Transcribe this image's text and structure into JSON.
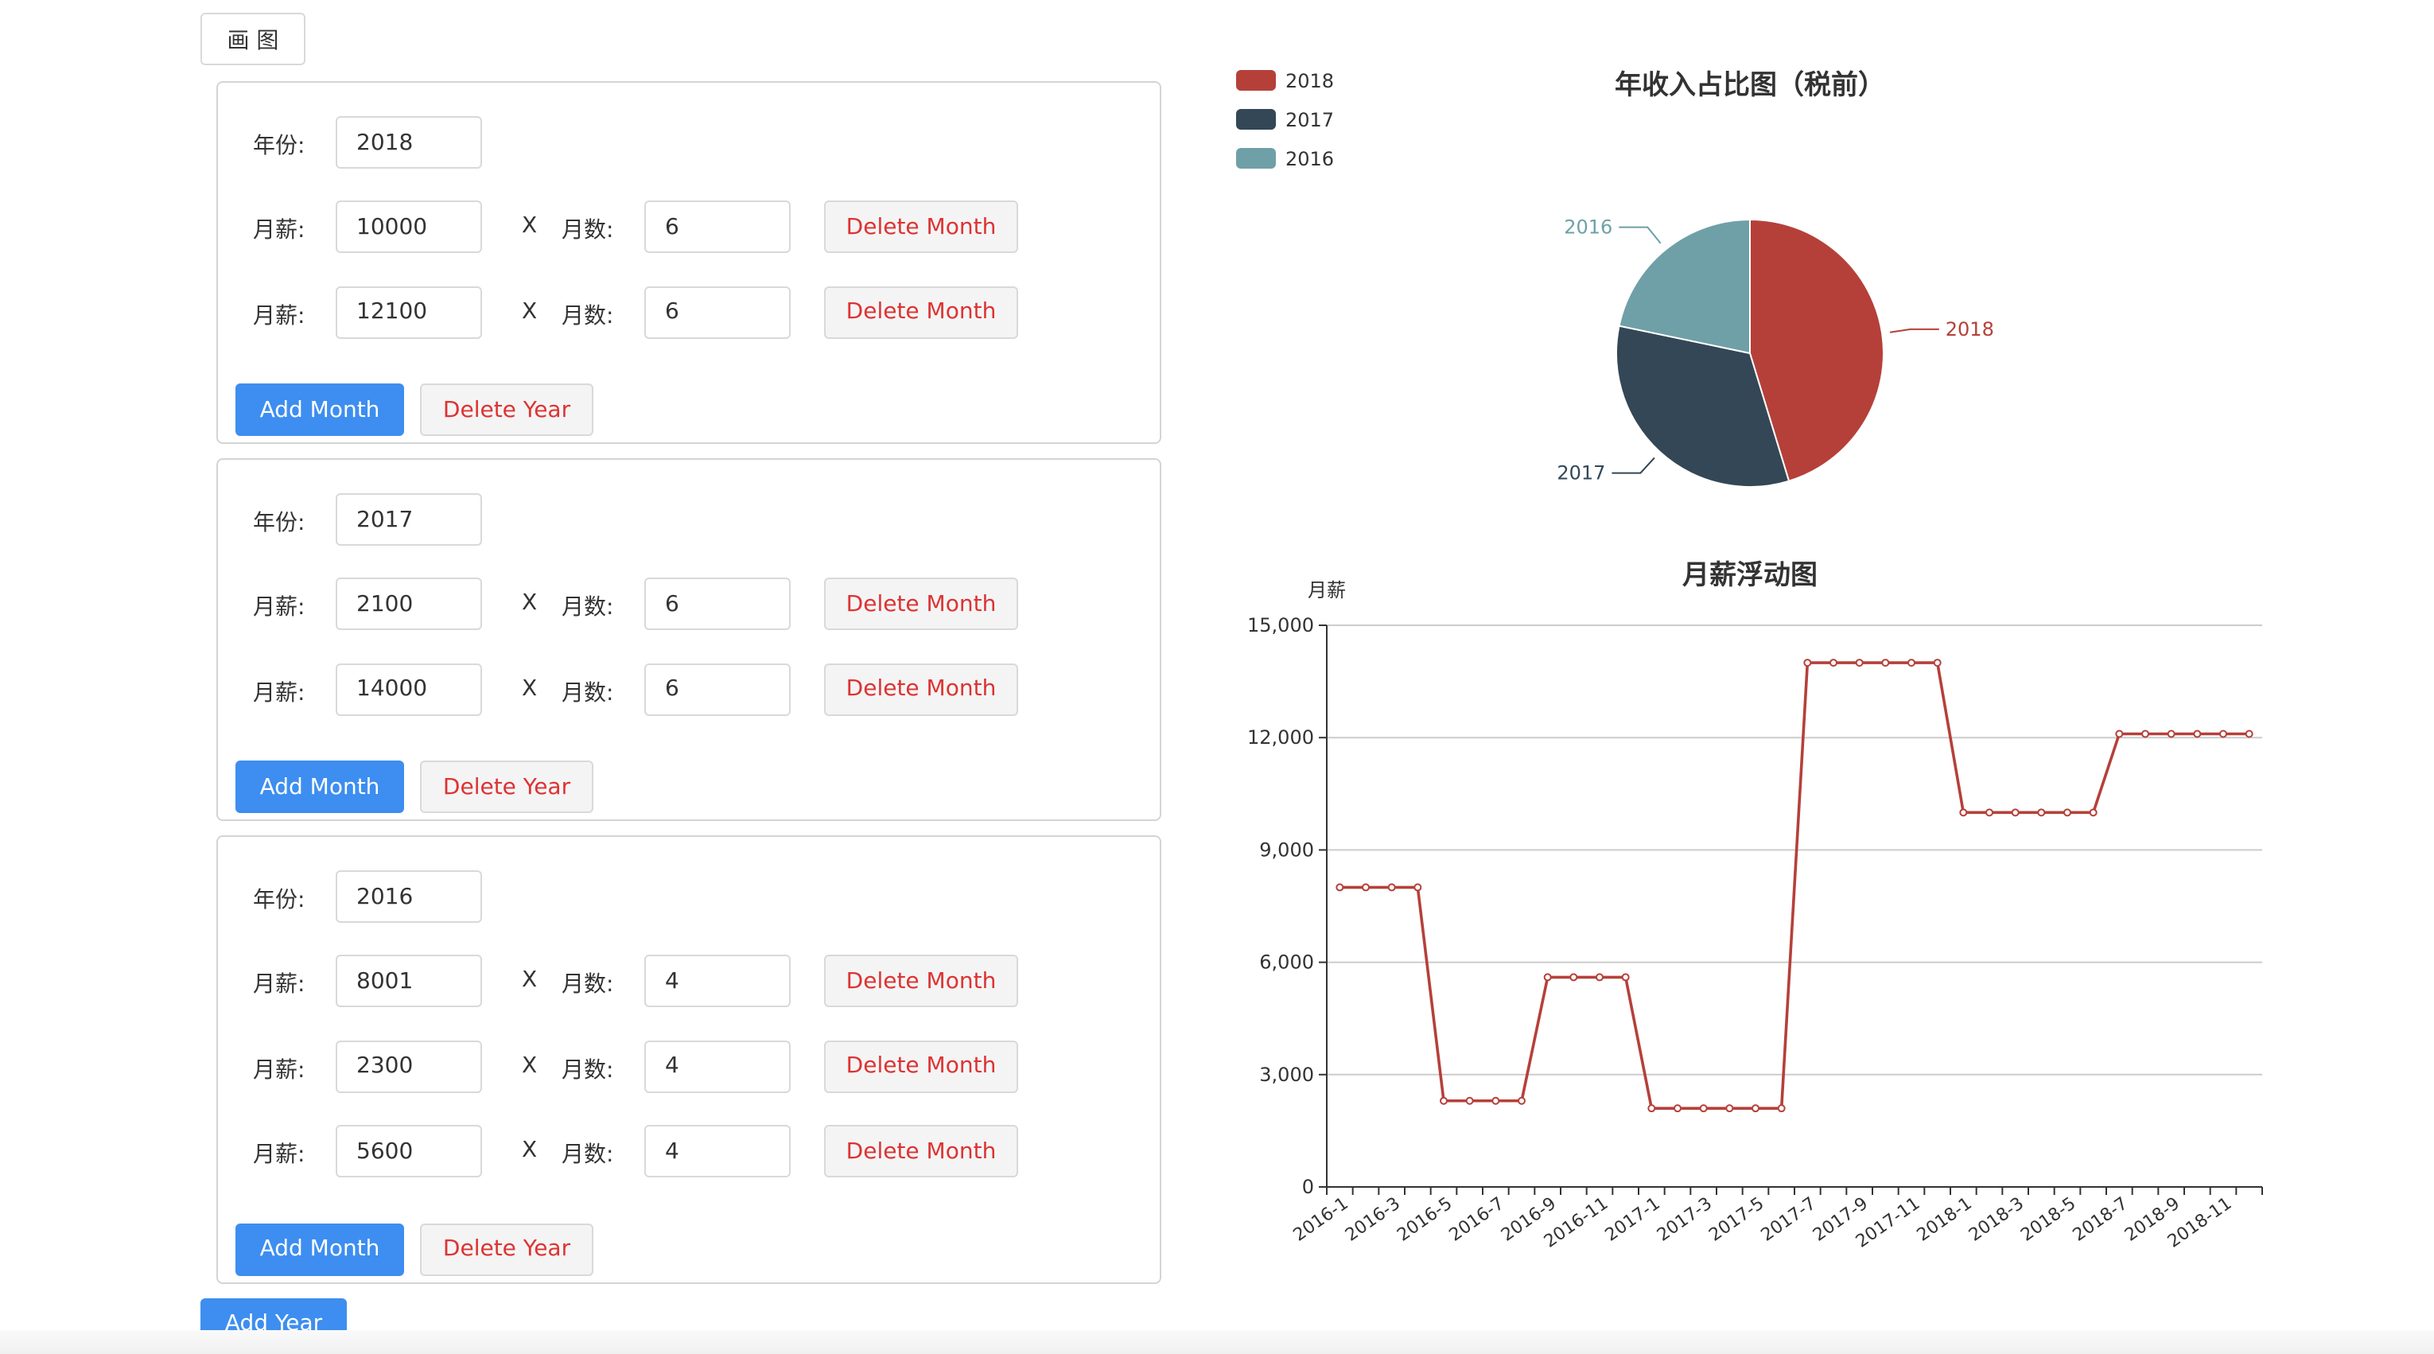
{
  "toolbar": {
    "draw_label": "画 图"
  },
  "labels": {
    "year": "年份:",
    "salary": "月薪:",
    "multiply": "X",
    "months": "月数:",
    "delete_month": "Delete Month",
    "add_month": "Add Month",
    "delete_year": "Delete Year",
    "add_year": "Add Year"
  },
  "years": [
    {
      "year": "2018",
      "rows": [
        {
          "salary": "10000",
          "months": "6"
        },
        {
          "salary": "12100",
          "months": "6"
        }
      ]
    },
    {
      "year": "2017",
      "rows": [
        {
          "salary": "2100",
          "months": "6"
        },
        {
          "salary": "14000",
          "months": "6"
        }
      ]
    },
    {
      "year": "2016",
      "rows": [
        {
          "salary": "8001",
          "months": "4"
        },
        {
          "salary": "2300",
          "months": "4"
        },
        {
          "salary": "5600",
          "months": "4"
        }
      ]
    }
  ],
  "colors": {
    "accent": "#3d8ef0",
    "danger": "#d33",
    "y2018": "#b5403a",
    "y2017": "#334756",
    "y2016": "#6fa0a7"
  },
  "chart_data": [
    {
      "type": "pie",
      "title": "年收入占比图（税前）",
      "legend": [
        "2018",
        "2017",
        "2016"
      ],
      "legend_placement": "top-left",
      "slices": [
        {
          "name": "2018",
          "value": 132600,
          "color": "#b5403a"
        },
        {
          "name": "2017",
          "value": 96600,
          "color": "#334756"
        },
        {
          "name": "2016",
          "value": 63604,
          "color": "#6fa0a7"
        }
      ]
    },
    {
      "type": "line",
      "title": "月薪浮动图",
      "ylabel": "月薪",
      "xlabel": "",
      "ylim": [
        0,
        15000
      ],
      "yticks": [
        "0",
        "3,000",
        "6,000",
        "9,000",
        "12,000",
        "15,000"
      ],
      "grid": true,
      "color": "#b5403a",
      "x": [
        "2016-1",
        "2016-2",
        "2016-3",
        "2016-4",
        "2016-5",
        "2016-6",
        "2016-7",
        "2016-8",
        "2016-9",
        "2016-10",
        "2016-11",
        "2016-12",
        "2017-1",
        "2017-2",
        "2017-3",
        "2017-4",
        "2017-5",
        "2017-6",
        "2017-7",
        "2017-8",
        "2017-9",
        "2017-10",
        "2017-11",
        "2017-12",
        "2018-1",
        "2018-2",
        "2018-3",
        "2018-4",
        "2018-5",
        "2018-6",
        "2018-7",
        "2018-8",
        "2018-9",
        "2018-10",
        "2018-11",
        "2018-12"
      ],
      "x_tick_labels": [
        "2016-1",
        "2016-3",
        "2016-5",
        "2016-7",
        "2016-9",
        "2016-11",
        "2017-1",
        "2017-3",
        "2017-5",
        "2017-7",
        "2017-9",
        "2017-11",
        "2018-1",
        "2018-3",
        "2018-5",
        "2018-7",
        "2018-9",
        "2018-11"
      ],
      "values": [
        8001,
        8001,
        8001,
        8001,
        2300,
        2300,
        2300,
        2300,
        5600,
        5600,
        5600,
        5600,
        2100,
        2100,
        2100,
        2100,
        2100,
        2100,
        14000,
        14000,
        14000,
        14000,
        14000,
        14000,
        10000,
        10000,
        10000,
        10000,
        10000,
        10000,
        12100,
        12100,
        12100,
        12100,
        12100,
        12100
      ]
    }
  ]
}
